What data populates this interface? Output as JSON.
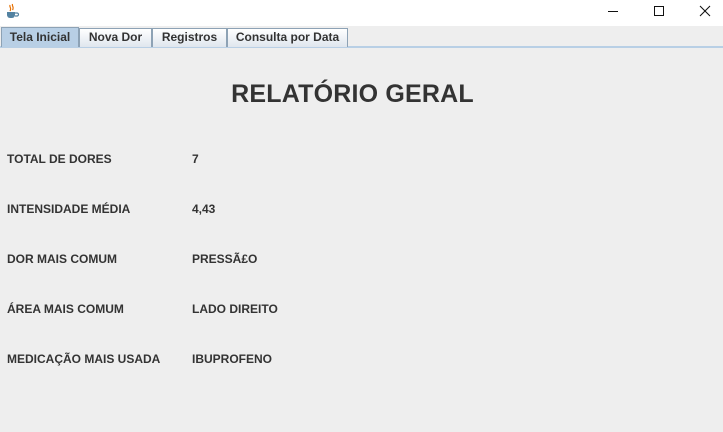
{
  "window": {
    "app_icon": "java-cup-icon",
    "controls": [
      "minimize-icon",
      "maximize-icon",
      "close-icon"
    ]
  },
  "tabs": [
    {
      "label": "Tela Inicial",
      "selected": true
    },
    {
      "label": "Nova Dor",
      "selected": false
    },
    {
      "label": "Registros",
      "selected": false
    },
    {
      "label": "Consulta por Data",
      "selected": false
    }
  ],
  "report": {
    "title": "RELATÓRIO GERAL",
    "rows": [
      {
        "label": "TOTAL DE DORES",
        "value": "7"
      },
      {
        "label": "INTENSIDADE MÉDIA",
        "value": "4,43"
      },
      {
        "label": "DOR MAIS COMUM",
        "value": "PRESSÃ£O"
      },
      {
        "label": "ÁREA MAIS COMUM",
        "value": "LADO DIREITO"
      },
      {
        "label": "MEDICAÇÃO MAIS USADA",
        "value": "IBUPROFENO"
      }
    ]
  },
  "colors": {
    "window_bg": "#eeeeee",
    "tab_selected": "#b8cfe5",
    "text": "#333333"
  }
}
